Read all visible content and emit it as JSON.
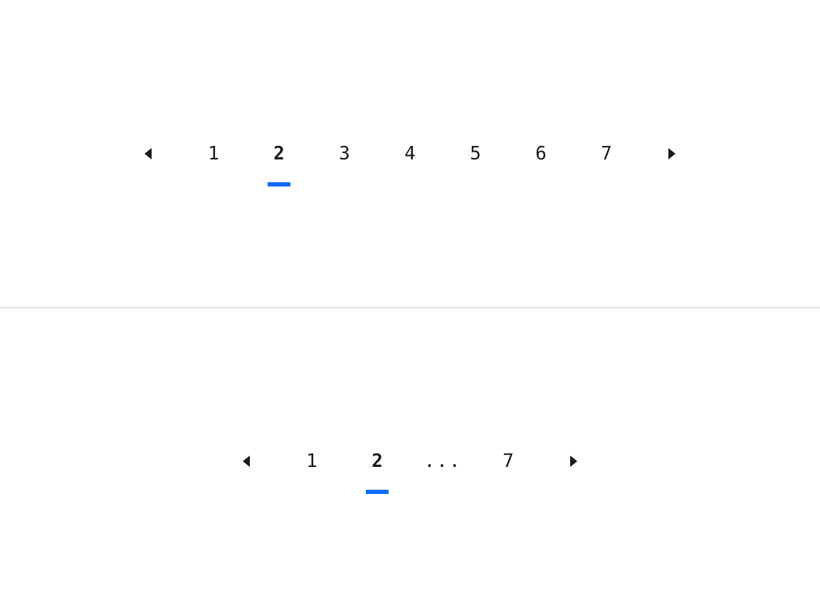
{
  "pagination_full": {
    "current_page": 2,
    "items": [
      {
        "label": "1",
        "type": "page"
      },
      {
        "label": "2",
        "type": "page",
        "current": true
      },
      {
        "label": "3",
        "type": "page"
      },
      {
        "label": "4",
        "type": "page"
      },
      {
        "label": "5",
        "type": "page"
      },
      {
        "label": "6",
        "type": "page"
      },
      {
        "label": "7",
        "type": "page"
      }
    ]
  },
  "pagination_compact": {
    "current_page": 2,
    "items": [
      {
        "label": "1",
        "type": "page"
      },
      {
        "label": "2",
        "type": "page",
        "current": true
      },
      {
        "label": "...",
        "type": "ellipsis"
      },
      {
        "label": "7",
        "type": "page"
      }
    ]
  },
  "colors": {
    "accent": "#0d6efd",
    "text": "#1a1a1a",
    "divider": "#cccccc"
  }
}
